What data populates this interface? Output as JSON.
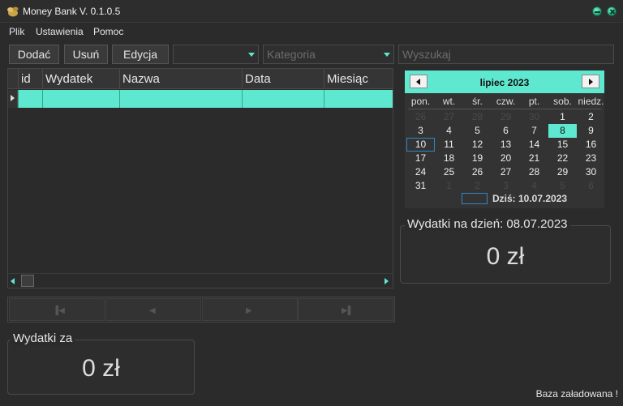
{
  "window": {
    "title": "Money Bank V. 0.1.0.5"
  },
  "menu": [
    "Plik",
    "Ustawienia",
    "Pomoc"
  ],
  "toolbar": {
    "add_label": "Dodać",
    "delete_label": "Usuń",
    "edit_label": "Edycja",
    "category_placeholder": "Kategoria",
    "search_placeholder": "Wyszukaj"
  },
  "grid": {
    "columns": [
      "id",
      "Wydatek",
      "Nazwa",
      "Data",
      "Miesiąc"
    ]
  },
  "calendar": {
    "month_label": "lipiec 2023",
    "weekdays": [
      "pon.",
      "wt.",
      "śr.",
      "czw.",
      "pt.",
      "sob.",
      "niedz."
    ],
    "weeks": [
      [
        "26",
        "27",
        "28",
        "29",
        "30",
        "1",
        "2"
      ],
      [
        "3",
        "4",
        "5",
        "6",
        "7",
        "8",
        "9"
      ],
      [
        "10",
        "11",
        "12",
        "13",
        "14",
        "15",
        "16"
      ],
      [
        "17",
        "18",
        "19",
        "20",
        "21",
        "22",
        "23"
      ],
      [
        "24",
        "25",
        "26",
        "27",
        "28",
        "29",
        "30"
      ],
      [
        "31",
        "1",
        "2",
        "3",
        "4",
        "5",
        "6"
      ]
    ],
    "selected_day": "8",
    "today_day": "10",
    "today_label": "Dziś: 10.07.2023"
  },
  "daily": {
    "title": "Wydatki na dzień:  08.07.2023",
    "value": "0 zł"
  },
  "period": {
    "title": "Wydatki za",
    "value": "0 zł"
  },
  "status": "Baza załadowana !",
  "colors": {
    "accent": "#5ee8d0",
    "background": "#2b2b2b",
    "today_border": "#2f87c8"
  }
}
